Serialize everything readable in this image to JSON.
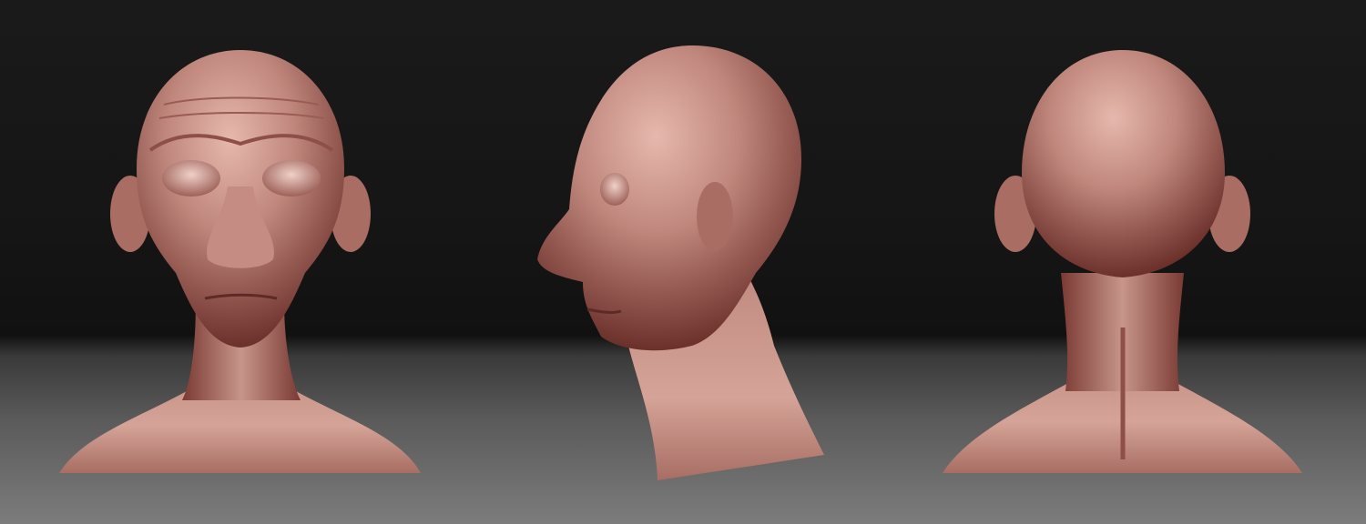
{
  "scene": {
    "background_top": "#151515",
    "floor_bottom": "#7c7c7c",
    "clay_color": "#b77a70",
    "clay_highlight": "#e2b1a6",
    "clay_shadow": "#5d2a25"
  },
  "views": [
    {
      "name": "front-view"
    },
    {
      "name": "side-view"
    },
    {
      "name": "back-view"
    }
  ]
}
